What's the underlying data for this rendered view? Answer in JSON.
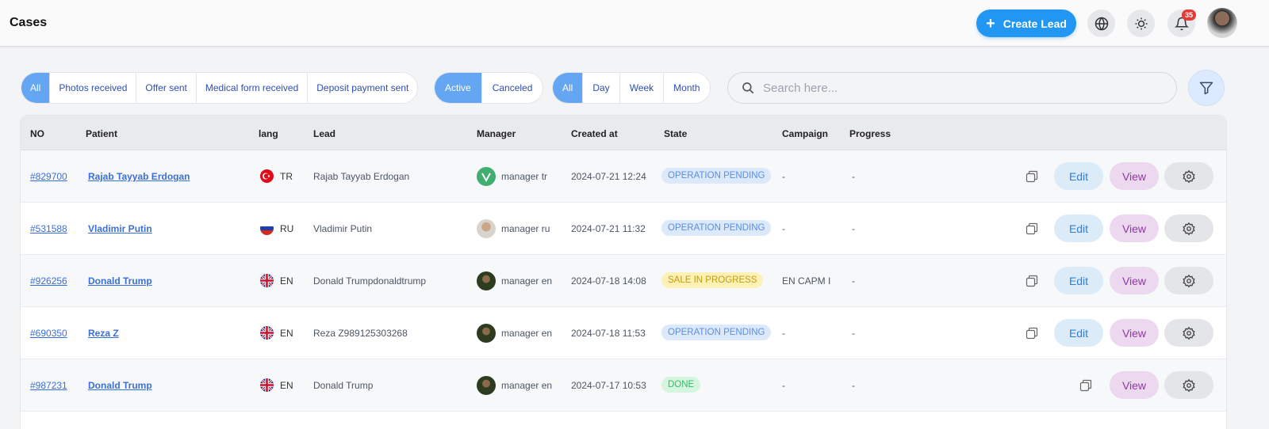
{
  "header": {
    "title": "Cases",
    "create_button": "Create Lead",
    "notification_count": "35"
  },
  "filters": {
    "status_options": [
      "All",
      "Photos received",
      "Offer sent",
      "Medical form received",
      "Deposit payment sent"
    ],
    "status_selected": "All",
    "activity_options": [
      "Active",
      "Canceled"
    ],
    "activity_selected": "Active",
    "period_options": [
      "All",
      "Day",
      "Week",
      "Month"
    ],
    "period_selected": "All"
  },
  "search": {
    "placeholder": "Search here..."
  },
  "table": {
    "columns": [
      "NO",
      "Patient",
      "lang",
      "Lead",
      "Manager",
      "Created at",
      "State",
      "Campaign",
      "Progress"
    ],
    "rows": [
      {
        "no": "#829700",
        "patient": "Rajab Tayyab Erdogan",
        "lang": "TR",
        "lead": "Rajab Tayyab Erdogan",
        "manager": "manager tr",
        "created": "2024-07-21 12:24",
        "state": "OPERATION PENDING",
        "campaign": "-",
        "progress": "-",
        "edit": "Edit",
        "view": "View"
      },
      {
        "no": "#531588",
        "patient": "Vladimir Putin",
        "lang": "RU",
        "lead": "Vladimir Putin",
        "manager": "manager ru",
        "created": "2024-07-21 11:32",
        "state": "OPERATION PENDING",
        "campaign": "-",
        "progress": "-",
        "edit": "Edit",
        "view": "View"
      },
      {
        "no": "#926256",
        "patient": "Donald Trump",
        "lang": "EN",
        "lead": "Donald Trumpdonaldtrump",
        "manager": "manager en",
        "created": "2024-07-18 14:08",
        "state": "SALE IN PROGRESS",
        "campaign": "EN CAPM I",
        "progress": "-",
        "edit": "Edit",
        "view": "View"
      },
      {
        "no": "#690350",
        "patient": "Reza Z",
        "lang": "EN",
        "lead": "Reza Z989125303268",
        "manager": "manager en",
        "created": "2024-07-18 11:53",
        "state": "OPERATION PENDING",
        "campaign": "-",
        "progress": "-",
        "edit": "Edit",
        "view": "View"
      },
      {
        "no": "#987231",
        "patient": "Donald Trump",
        "lang": "EN",
        "lead": "Donald Trump",
        "manager": "manager en",
        "created": "2024-07-17 10:53",
        "state": "DONE",
        "campaign": "-",
        "progress": "-",
        "view": "View"
      }
    ]
  },
  "colors": {
    "accent": "#2196f3",
    "segment_active": "#64a6f2",
    "state_pending": "#dbe9fb",
    "state_sale": "#fdf1b5",
    "state_done": "#d6f5de"
  },
  "icons": [
    "plus-icon",
    "globe-icon",
    "sun-icon",
    "bell-icon",
    "search-icon",
    "filter-icon",
    "copy-icon",
    "gear-icon"
  ]
}
